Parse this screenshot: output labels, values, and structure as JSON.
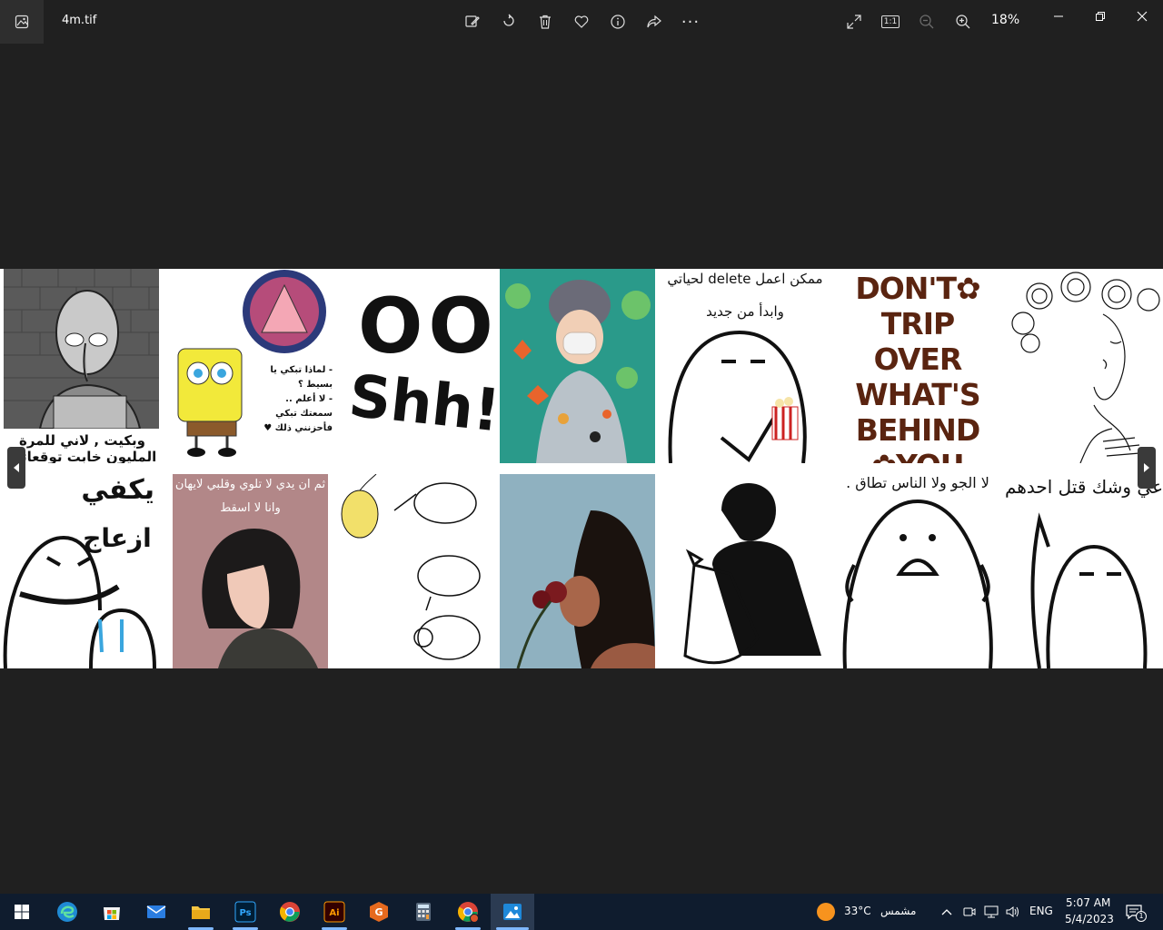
{
  "window": {
    "filename": "4m.tif",
    "zoom": "18%",
    "actual_size_label": "1:1"
  },
  "toolbar": {
    "edit": "edit-image",
    "rotate": "rotate",
    "delete": "delete",
    "favorite": "favorite",
    "info": "info",
    "share": "share",
    "more": "···"
  },
  "tiles": {
    "squidward_caption": "وبكيت , لاني للمرة المليون خابت توقعاتي",
    "sponge_line1": "- لماذا تبكي يا بسيط ؟",
    "sponge_line2": "- لا أعلم ..",
    "sponge_line3": "سمعتك تبكي",
    "sponge_line4": "فأحزنني ذلك ♥",
    "oo_shh_top": "OO",
    "oo_shh_bottom": "Shh!",
    "delete_line1": "ممكن اعمل delete لحياتي",
    "delete_line2": "وابدأ من جديد",
    "trip_1": "DON'T✿",
    "trip_2": "TRIP OVER",
    "trip_3": "WHAT'S",
    "trip_4": "BEHIND",
    "trip_5": "✿YOU",
    "yakfi_1": "يكفي",
    "yakfi_2": "ازعاج",
    "pink_line1": "ثم ان يدي لا تلوي وقلبي لايهان",
    "pink_line2": "وانا لا اسقط",
    "nas_caption": "لا الجو ولا الناس تطاق .",
    "wajh_caption": "عي وشك قتل احدهم"
  },
  "taskbar": {
    "weather_temp": "33°C",
    "weather_text": "مشمس",
    "language": "ENG",
    "time": "5:07 AM",
    "date": "5/4/2023",
    "notifications": "1"
  },
  "colors": {
    "background": "#202020",
    "taskbar": "#0f1c2e",
    "accent": "#7fb8ff"
  }
}
